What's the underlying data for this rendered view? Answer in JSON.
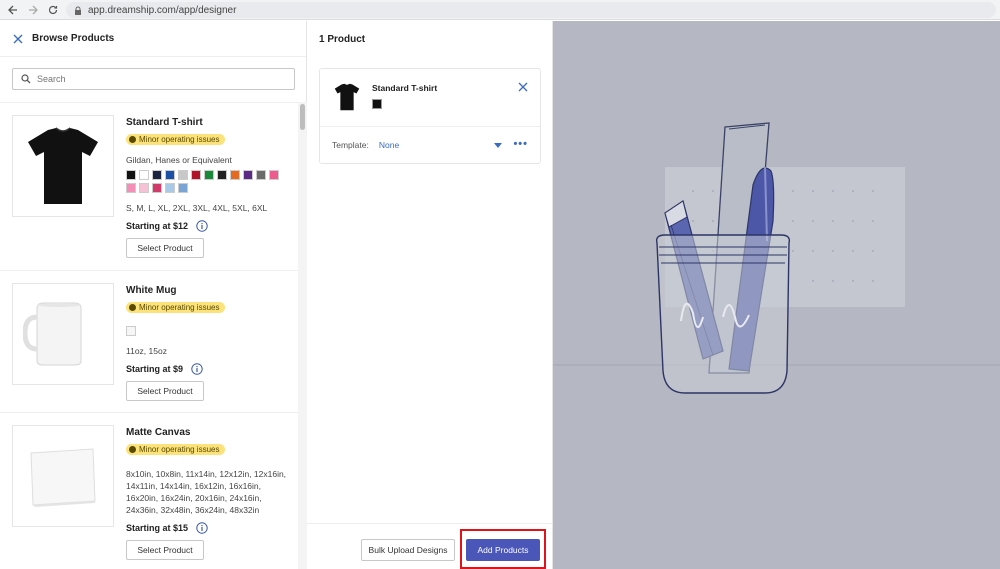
{
  "browser": {
    "url": "app.dreamship.com/app/designer"
  },
  "left": {
    "title": "Browse Products",
    "search_placeholder": "Search",
    "products": [
      {
        "name": "Standard T-shirt",
        "badge": "Minor operating issues",
        "brand": "Gildan, Hanes or Equivalent",
        "swatches": [
          "#111111",
          "#ffffff",
          "#1c2340",
          "#1c4fa8",
          "#c8c8c8",
          "#b3122a",
          "#1a8a3a",
          "#222222",
          "#e56a1f",
          "#5b2a86",
          "#6b6b6b",
          "#ef5b8e",
          "#f48fb8",
          "#f6c1d5",
          "#d13a6a",
          "#a9c9e8",
          "#7aa3d6"
        ],
        "sizes": "S, M, L, XL, 2XL, 3XL, 4XL, 5XL, 6XL",
        "price": "Starting at $12",
        "button": "Select Product"
      },
      {
        "name": "White Mug",
        "badge": "Minor operating issues",
        "swatches": [
          "#f6f6f6"
        ],
        "sizes": "11oz, 15oz",
        "price": "Starting at $9",
        "button": "Select Product"
      },
      {
        "name": "Matte Canvas",
        "badge": "Minor operating issues",
        "sizes": "8x10in, 10x8in, 11x14in, 12x12in, 12x16in, 14x11in, 14x14in, 16x12in, 16x16in, 16x20in, 16x24in, 20x16in, 24x16in, 24x36in, 32x48in, 36x24in, 48x32in",
        "price": "Starting at $15",
        "button": "Select Product"
      }
    ]
  },
  "middle": {
    "title": "1 Product",
    "card": {
      "name": "Standard T-shirt",
      "swatch": "#111111",
      "template_label": "Template:",
      "template_value": "None"
    },
    "bulk_label": "Bulk Upload Designs",
    "add_label": "Add Products"
  }
}
